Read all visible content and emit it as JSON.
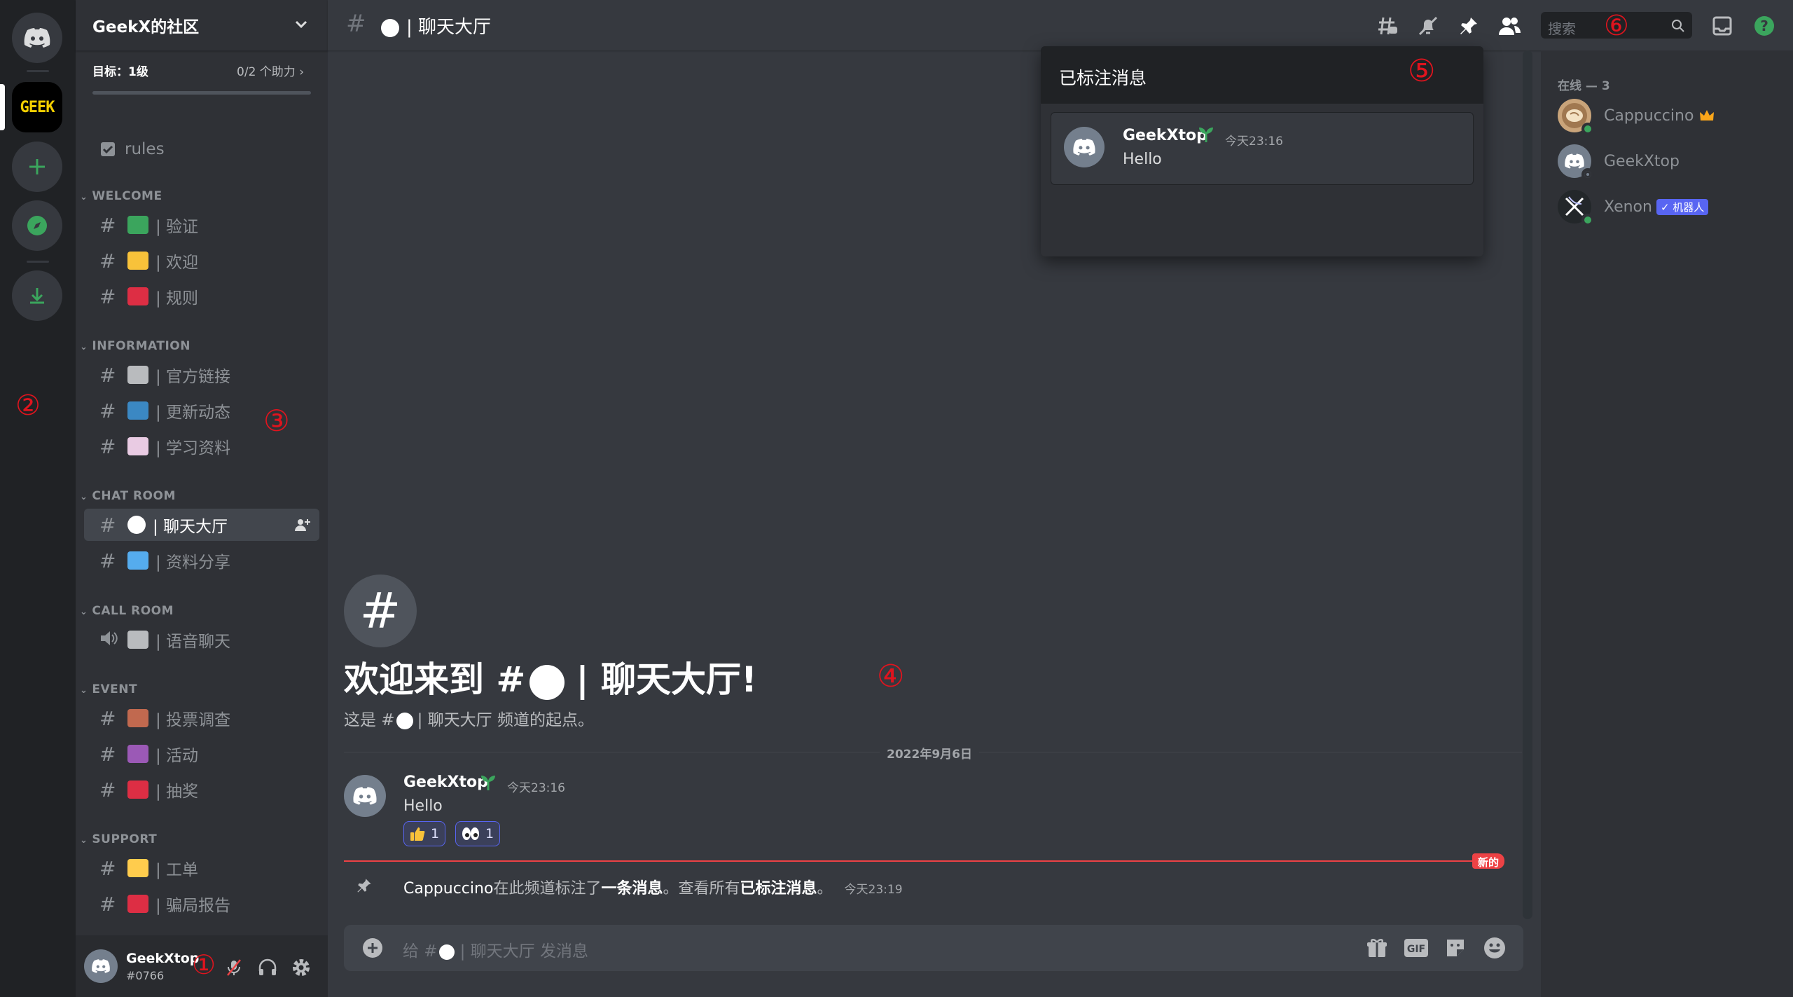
{
  "server": {
    "name": "GeekX的社区",
    "goal_label": "目标：1级",
    "goal_progress_text": "0/2 个助力",
    "goal_progress": 0.0,
    "rail_logo_text": "GEEK"
  },
  "channels": {
    "rules": "rules",
    "categories": [
      {
        "name": "WELCOME",
        "items": [
          {
            "prefix": "#",
            "label": "| 验证",
            "emoji": "green-check-emoji"
          },
          {
            "prefix": "#",
            "label": "| 欢迎",
            "emoji": "wave-emoji"
          },
          {
            "prefix": "#",
            "label": "| 规则",
            "emoji": "book-emoji"
          }
        ]
      },
      {
        "name": "INFORMATION",
        "items": [
          {
            "prefix": "#",
            "label": "| 官方链接",
            "emoji": "link-emoji"
          },
          {
            "prefix": "#",
            "label": "| 更新动态",
            "emoji": "new-emoji"
          },
          {
            "prefix": "#",
            "label": "| 学习资料",
            "emoji": "bookmark-emoji"
          }
        ]
      },
      {
        "name": "CHAT ROOM",
        "items": [
          {
            "prefix": "#",
            "label": "| 聊天大厅",
            "emoji": "white-circle"
          },
          {
            "prefix": "#",
            "label": "| 资料分享",
            "emoji": "books-emoji"
          }
        ]
      },
      {
        "name": "CALL ROOM",
        "items": [
          {
            "prefix": "speaker",
            "label": "| 语音聊天",
            "emoji": "microphone-emoji"
          }
        ]
      },
      {
        "name": "EVENT",
        "items": [
          {
            "prefix": "#",
            "label": "| 投票调查",
            "emoji": "clipboard-emoji"
          },
          {
            "prefix": "#",
            "label": "| 活动",
            "emoji": "masks-emoji"
          },
          {
            "prefix": "#",
            "label": "| 抽奖",
            "emoji": "gift-emoji"
          }
        ]
      },
      {
        "name": "SUPPORT",
        "items": [
          {
            "prefix": "#",
            "label": "| 工单",
            "emoji": "ticket-emoji"
          },
          {
            "prefix": "#",
            "label": "| 骗局报告",
            "emoji": "siren-emoji"
          }
        ]
      }
    ]
  },
  "user": {
    "name": "GeekXtop",
    "tag": "#0766"
  },
  "header": {
    "channel": "| 聊天大厅",
    "search_placeholder": "搜索"
  },
  "pinned": {
    "title": "已标注消息",
    "author": "GeekXtop",
    "time": "今天23:16",
    "text": "Hello"
  },
  "members": {
    "heading": "在线 — 3",
    "list": [
      {
        "name": "Cappuccino",
        "status": "online"
      },
      {
        "name": "GeekXtop",
        "status": "offline"
      },
      {
        "name": "Xenon",
        "status": "online",
        "badge": "✓ 机器人"
      }
    ]
  },
  "chat": {
    "welcome_title_a": "欢迎来到 #",
    "welcome_title_b": "| 聊天大厅!",
    "welcome_sub_a": "这是 #",
    "welcome_sub_b": "| 聊天大厅 频道的起点。",
    "date_divider": "2022年9月6日",
    "message": {
      "author": "GeekXtop",
      "time": "今天23:16",
      "text": "Hello"
    },
    "reactions": [
      {
        "emoji": "thumbs-up-emoji",
        "count": "1"
      },
      {
        "emoji": "eyes-emoji",
        "count": "1"
      }
    ],
    "new_label": "新的",
    "system": {
      "user": "Cappuccino",
      "part1": "在此频道标注了",
      "link1": "一条消息",
      "part2": "。查看所有",
      "link2": "已标注消息",
      "part3": "。",
      "time": "今天23:19"
    },
    "composer_placeholder_a": "给 #",
    "composer_placeholder_b": "| 聊天大厅 发消息"
  },
  "annotations": [
    "①",
    "②",
    "③",
    "④",
    "⑤",
    "⑥"
  ],
  "colors": {
    "blurple": "#5865f2",
    "online": "#3ba55d",
    "red": "#ed4245",
    "annotation": "#e0141e"
  }
}
